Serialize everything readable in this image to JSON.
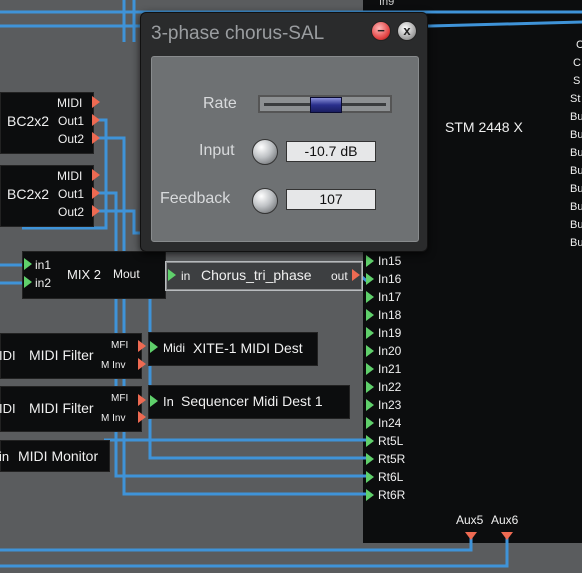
{
  "plugin_window": {
    "title": "3-phase chorus-SAL",
    "minimize_glyph": "−",
    "close_glyph": "x",
    "rate_label": "Rate",
    "rate_value_fraction": 0.5,
    "input_label": "Input",
    "input_value": "-10.7 dB",
    "feedback_label": "Feedback",
    "feedback_value": "107"
  },
  "modules": {
    "bc1": {
      "name": "BC2x2",
      "ports": [
        "MIDI",
        "Out1",
        "Out2"
      ]
    },
    "bc2": {
      "name": "BC2x2",
      "ports": [
        "MIDI",
        "Out1",
        "Out2"
      ]
    },
    "mix": {
      "name": "MIX 2",
      "in1": "in1",
      "in2": "in2",
      "out": "Mout"
    },
    "chorus": {
      "name": "Chorus_tri_phase",
      "in": "in",
      "out": "out"
    },
    "filter1": {
      "prefix": "IDI",
      "name": "MIDI Filter",
      "port_a": "MFI",
      "port_b": "M Inv"
    },
    "filter2": {
      "prefix": "IDI",
      "name": "MIDI Filter",
      "port_a": "MFI",
      "port_b": "M Inv"
    },
    "xite": {
      "in": "Midi",
      "name": "XITE-1 MIDI Dest"
    },
    "seq": {
      "in": "In",
      "name": "Sequencer Midi Dest 1"
    },
    "monitor": {
      "prefix": "in",
      "name": "MIDI Monitor"
    },
    "stm": {
      "name": "STM 2448 X",
      "inputs": [
        "In15",
        "In16",
        "In17",
        "In18",
        "In19",
        "In20",
        "In21",
        "In22",
        "In23",
        "In24",
        "Rt5L",
        "Rt5R",
        "Rt6L",
        "Rt6R"
      ],
      "aux": [
        "Aux5",
        "Aux6"
      ],
      "top_fragment": "In9"
    },
    "right_partial": {
      "labels": [
        "C",
        "C",
        "S",
        "St",
        "Bu",
        "Bu",
        "Bu",
        "Bu",
        "Bu",
        "Bu",
        "Bu",
        "Bu"
      ]
    }
  },
  "colors": {
    "wire": "#3f93d8",
    "wire_highlight": "#7ec1f2",
    "out_port": "#ee6a52",
    "in_port": "#5fd06b",
    "workspace": "#5a5c5e"
  }
}
